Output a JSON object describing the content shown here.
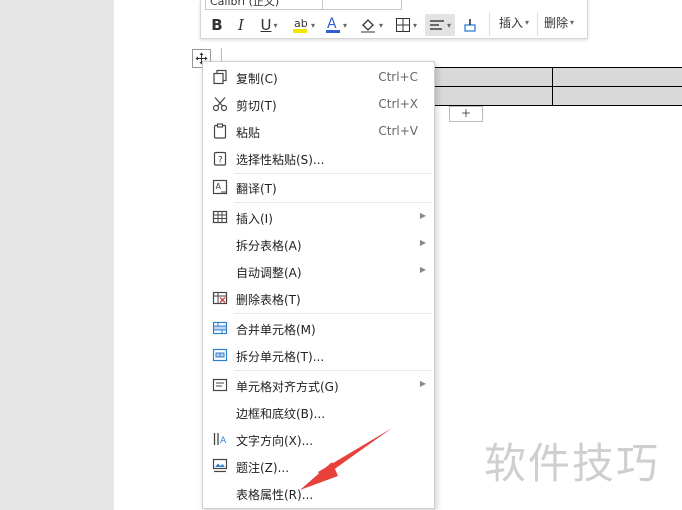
{
  "toolbar": {
    "font_name": "Calibri (正文)",
    "insert_label": "插入",
    "delete_label": "删除",
    "bold": "B",
    "italic": "I",
    "underline": "U",
    "font_color": "A"
  },
  "table": {
    "add_row_label": "+"
  },
  "menu": {
    "items": [
      {
        "label": "复制(C)",
        "shortcut": "Ctrl+C",
        "icon": "copy-icon"
      },
      {
        "label": "剪切(T)",
        "shortcut": "Ctrl+X",
        "icon": "cut-icon"
      },
      {
        "label": "粘贴",
        "shortcut": "Ctrl+V",
        "icon": "paste-icon"
      },
      {
        "label": "选择性粘贴(S)...",
        "shortcut": "",
        "icon": "paste-special-icon"
      },
      {
        "label": "翻译(T)",
        "shortcut": "",
        "icon": "translate-icon"
      },
      {
        "label": "插入(I)",
        "shortcut": "",
        "icon": "table-insert-icon"
      },
      {
        "label": "拆分表格(A)",
        "shortcut": "",
        "icon": ""
      },
      {
        "label": "自动调整(A)",
        "shortcut": "",
        "icon": ""
      },
      {
        "label": "删除表格(T)",
        "shortcut": "",
        "icon": "table-delete-icon"
      },
      {
        "label": "合并单元格(M)",
        "shortcut": "",
        "icon": "merge-cells-icon"
      },
      {
        "label": "拆分单元格(T)...",
        "shortcut": "",
        "icon": "split-cells-icon"
      },
      {
        "label": "单元格对齐方式(G)",
        "shortcut": "",
        "icon": "cell-align-icon"
      },
      {
        "label": "边框和底纹(B)...",
        "shortcut": "",
        "icon": ""
      },
      {
        "label": "文字方向(X)...",
        "shortcut": "",
        "icon": "text-direction-icon"
      },
      {
        "label": "题注(Z)...",
        "shortcut": "",
        "icon": "caption-icon"
      },
      {
        "label": "表格属性(R)...",
        "shortcut": "",
        "icon": ""
      }
    ]
  },
  "watermark": "软件技巧",
  "colors": {
    "highlight": "#f5e600",
    "font_color": "#2f5fd0",
    "arrow": "#e8413c",
    "table_fill": "#d9d9d9"
  }
}
